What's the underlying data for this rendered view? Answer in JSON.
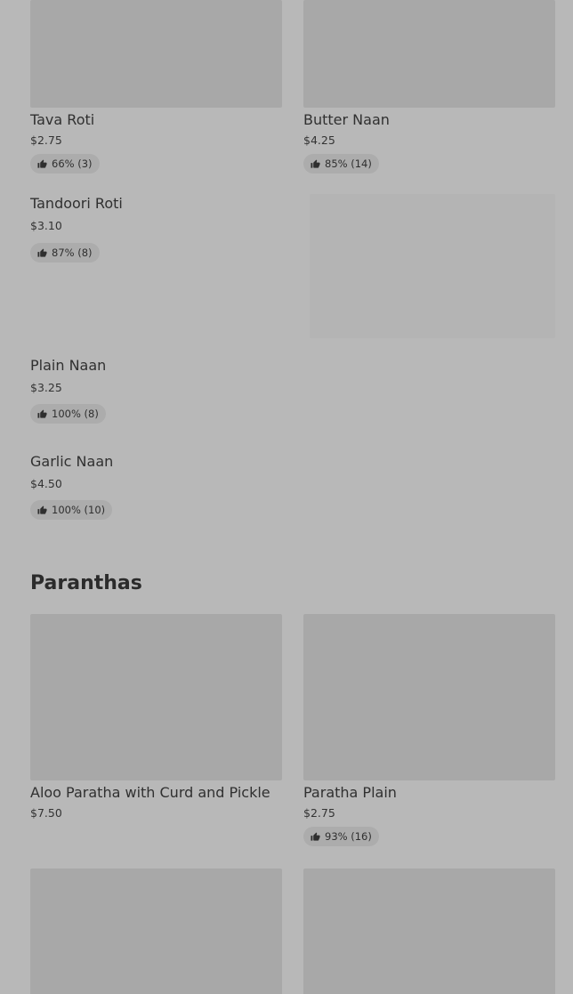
{
  "naan_roti": {
    "items": [
      {
        "name": "Tava Roti",
        "price": "$2.75",
        "rating": "66% (3)"
      },
      {
        "name": "Butter Naan",
        "price": "$4.25",
        "rating": "85% (14)"
      },
      {
        "name": "Tandoori Roti",
        "price": "$3.10",
        "rating": "87% (8)"
      },
      {
        "name": "Plain Naan",
        "price": "$3.25",
        "rating": "100% (8)"
      },
      {
        "name": "Garlic Naan",
        "price": "$4.50",
        "rating": "100% (10)"
      }
    ]
  },
  "paranthas": {
    "title": "Paranthas",
    "items": [
      {
        "name": "Aloo Paratha with Curd and Pickle",
        "price": "$7.50"
      },
      {
        "name": "Paratha Plain",
        "price": "$2.75",
        "rating": "93% (16)"
      }
    ]
  },
  "icons": {
    "rating": "thumbs-up-icon"
  },
  "colors": {
    "overlay_background": "#b8b8b8",
    "image_placeholder": "#a8a8a8"
  }
}
